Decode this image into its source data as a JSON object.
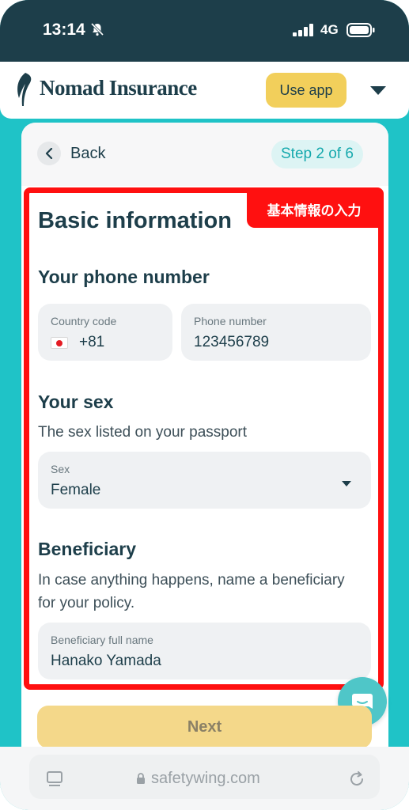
{
  "status_bar": {
    "time": "13:14",
    "network": "4G"
  },
  "header": {
    "brand": "Nomad Insurance",
    "use_app_label": "Use app"
  },
  "nav": {
    "back_label": "Back",
    "step": "Step 2 of 6"
  },
  "form": {
    "title": "Basic information",
    "phone": {
      "heading": "Your phone number",
      "country_code_label": "Country code",
      "country_code_value": "+81",
      "phone_label": "Phone number",
      "phone_value": "123456789"
    },
    "sex": {
      "heading": "Your sex",
      "help": "The sex listed on your passport",
      "label": "Sex",
      "value": "Female"
    },
    "beneficiary": {
      "heading": "Beneficiary",
      "help": "In case anything happens, name a beneficiary for your policy.",
      "label": "Beneficiary full name",
      "value": "Hanako Yamada"
    }
  },
  "annotation": {
    "label": "基本情報の入力",
    "color": "#ff1010"
  },
  "next_label": "Next",
  "browser": {
    "url": "safetywing.com"
  },
  "colors": {
    "brand_dark": "#1d3e4a",
    "teal": "#1fc3c7",
    "yellow": "#f2cf5b"
  }
}
